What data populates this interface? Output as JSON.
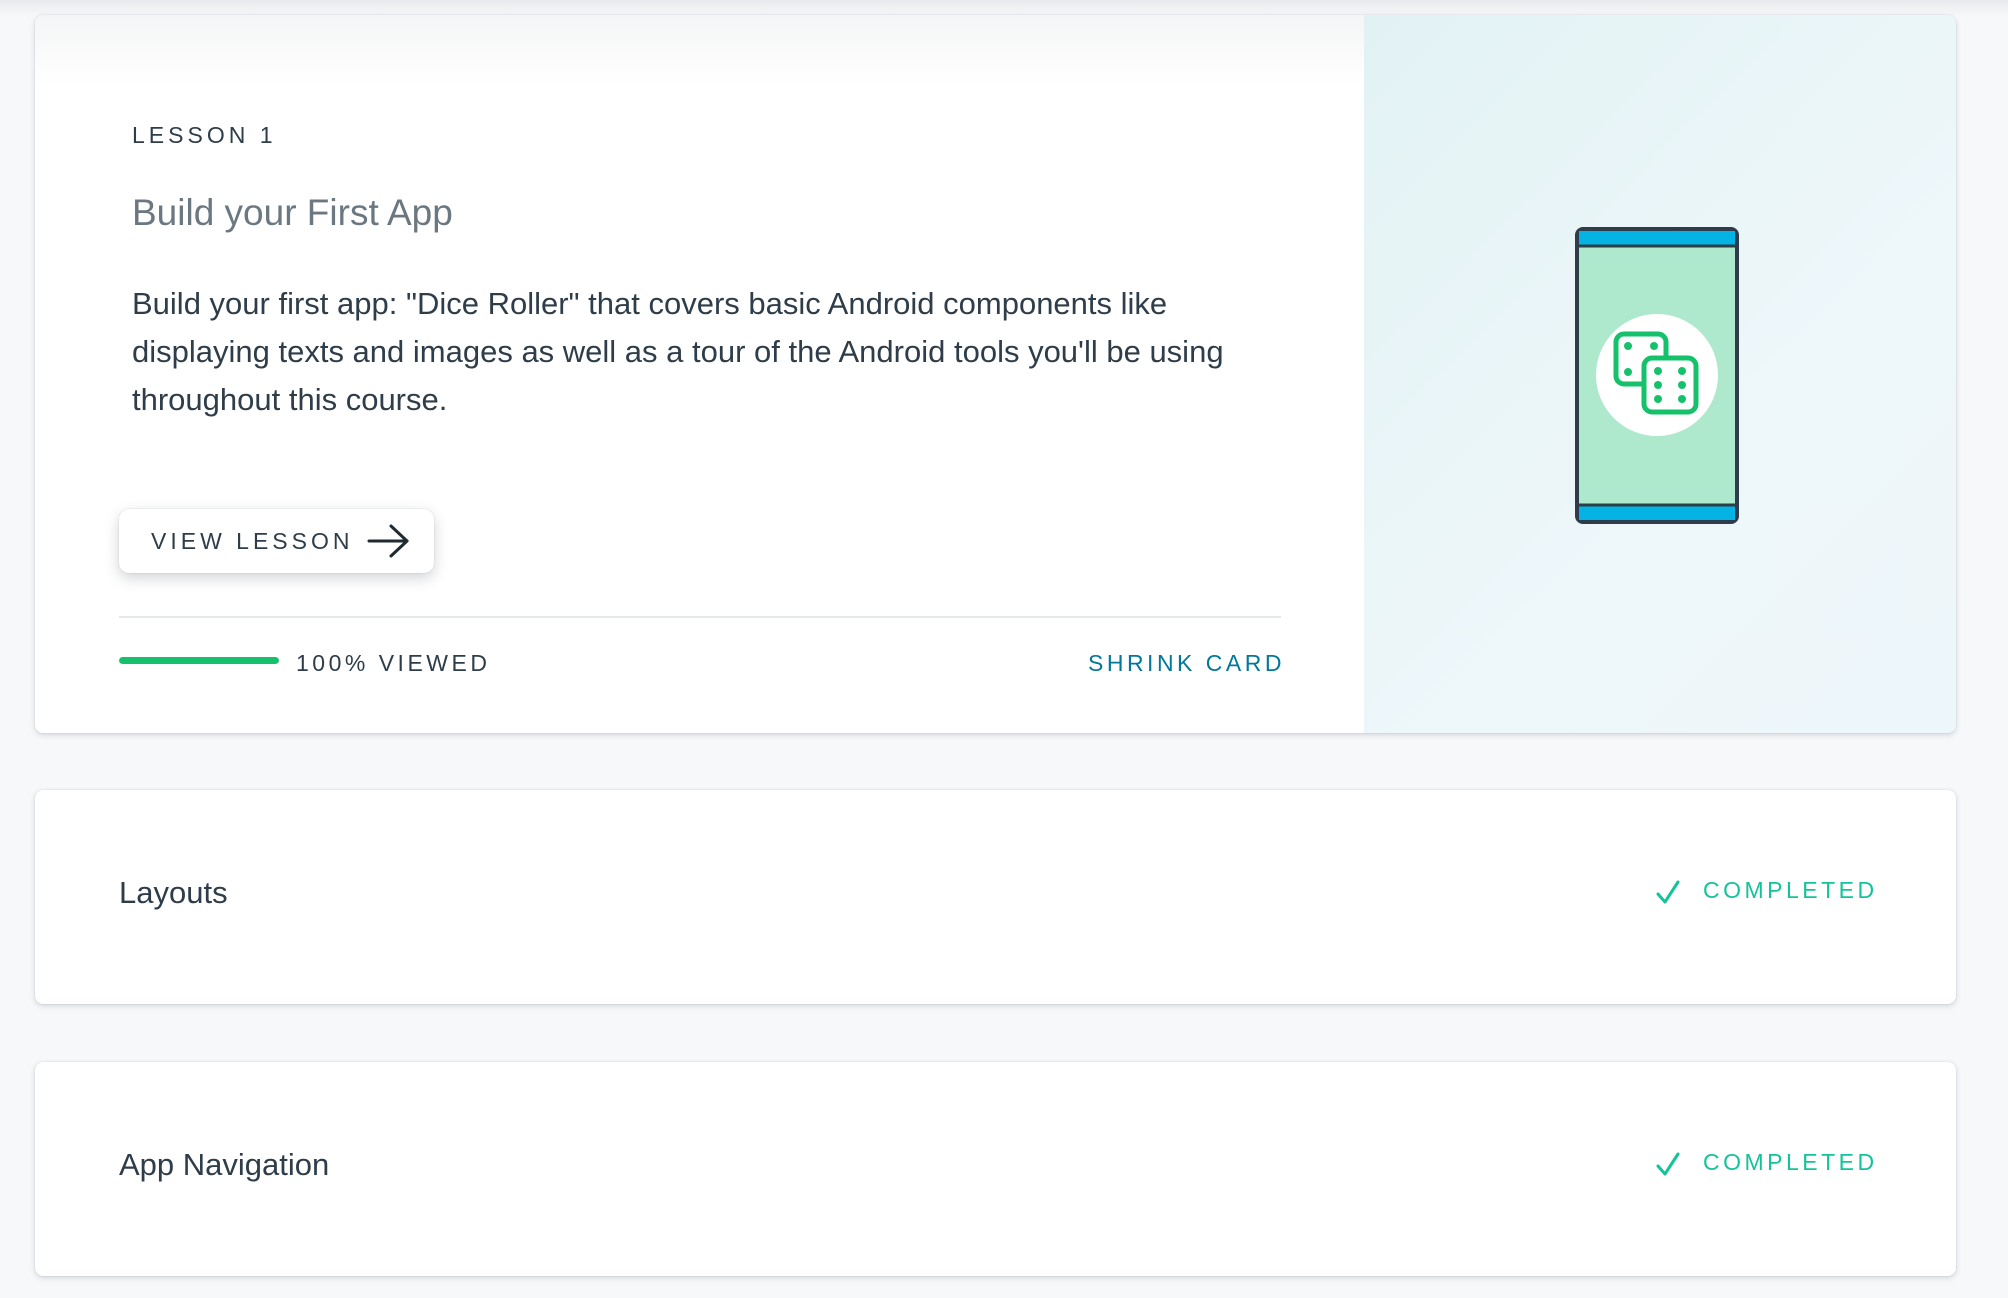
{
  "lesson": {
    "kicker": "LESSON 1",
    "title": "Build your First App",
    "description": "Build your first app: \"Dice Roller\" that covers basic Android components like displaying texts and images as well as a tour of the Android tools you'll be using throughout this course.",
    "view_button_label": "VIEW LESSON",
    "progress_fraction": 1.0,
    "progress_label": "100% VIEWED",
    "shrink_label": "SHRINK CARD",
    "illustration": "phone-dice-icon"
  },
  "collapsed_lessons": [
    {
      "title": "Layouts",
      "status": "COMPLETED",
      "status_icon": "check-icon"
    },
    {
      "title": "App Navigation",
      "status": "COMPLETED",
      "status_icon": "check-icon"
    }
  ],
  "colors": {
    "text_dark": "#2e3d49",
    "title_gray": "#6b7781",
    "link_teal": "#02789c",
    "progress_green": "#15c26b",
    "completed_green": "#15c39a",
    "phone_screen": "#aee8cd",
    "phone_bars": "#02b3e4",
    "dice_green": "#15c26b"
  }
}
